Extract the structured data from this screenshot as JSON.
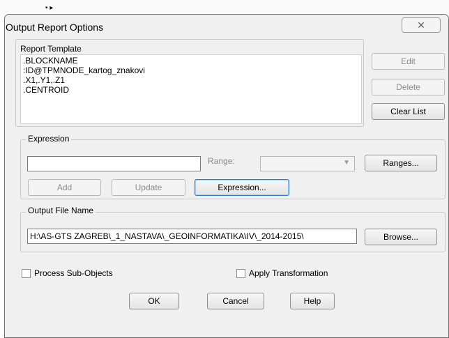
{
  "dialog": {
    "title": "Output Report Options",
    "close_glyph": "✕"
  },
  "report_template": {
    "label": "Report Template",
    "lines": [
      ".BLOCKNAME",
      ":ID@TPMNODE_kartog_znakovi",
      ".X1,.Y1,.Z1",
      ".CENTROID"
    ],
    "buttons": {
      "edit": "Edit",
      "delete": "Delete",
      "clear": "Clear List"
    }
  },
  "expression": {
    "label": "Expression",
    "value": "",
    "range_label": "Range:",
    "range_value": "",
    "ranges_button": "Ranges...",
    "add_button": "Add",
    "update_button": "Update",
    "expression_button": "Expression..."
  },
  "output_file": {
    "label": "Output File Name",
    "value": "H:\\AS-GTS ZAGREB\\_1_NASTAVA\\_GEOINFORMATIKA\\IV\\_2014-2015\\",
    "browse_button": "Browse..."
  },
  "options": {
    "process_sub_objects": {
      "label": "Process Sub-Objects",
      "checked": false
    },
    "apply_transformation": {
      "label": "Apply Transformation",
      "checked": false
    }
  },
  "footer": {
    "ok": "OK",
    "cancel": "Cancel",
    "help": "Help"
  }
}
